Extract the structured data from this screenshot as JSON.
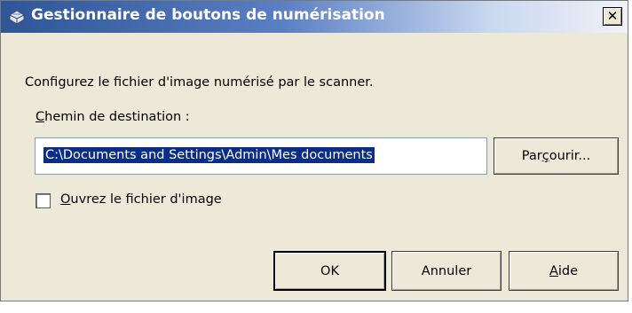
{
  "window": {
    "title": "Gestionnaire de boutons de numérisation",
    "close_glyph": "✕",
    "app_icon": "scanner-icon"
  },
  "dialog": {
    "instruction": "Configurez le fichier d'image numérisé par le scanner.",
    "path_label_mnemonic": "C",
    "path_label_rest": "hemin de destination :",
    "path_value": "C:\\Documents and Settings\\Admin\\Mes documents",
    "browse_pre": "Par",
    "browse_mnemonic": "ç",
    "browse_post": "ourir...",
    "checkbox_mnemonic": "O",
    "checkbox_rest": "uvrez le fichier d'image",
    "checkbox_checked": false
  },
  "buttons": {
    "ok": "OK",
    "cancel": "Annuler",
    "help_mnemonic": "A",
    "help_rest": "ide"
  }
}
